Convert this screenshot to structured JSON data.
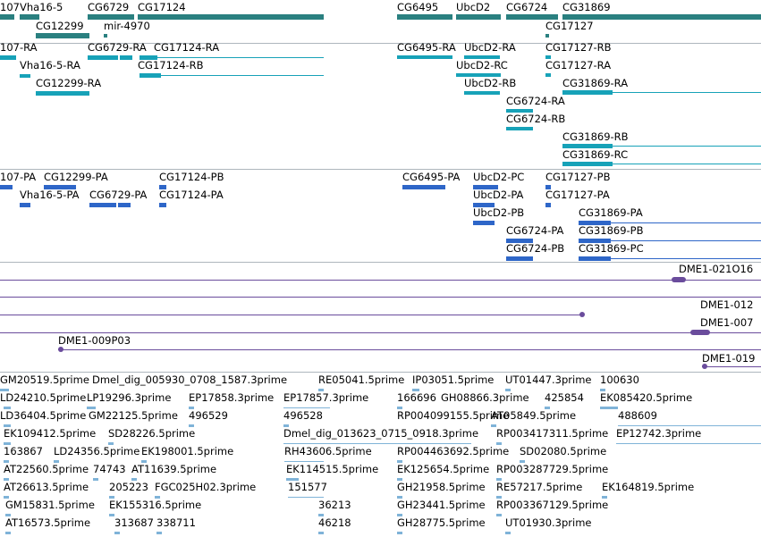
{
  "tracks": {
    "genes": {
      "labels": [
        "107",
        "Vha16-5",
        "CG6729",
        "CG17124",
        "CG12299",
        "mir-4970",
        "CG6495",
        "UbcD2",
        "CG6724",
        "CG31869",
        "CG17127"
      ]
    },
    "transcripts": {
      "labels": [
        "107-RA",
        "Vha16-5-RA",
        "CG12299-RA",
        "CG6729-RA",
        "CG17124-RA",
        "CG17124-RB",
        "CG6495-RA",
        "UbcD2-RA",
        "UbcD2-RC",
        "UbcD2-RB",
        "CG17127-RB",
        "CG17127-RA",
        "CG31869-RA",
        "CG6724-RA",
        "CG6724-RB",
        "CG31869-RB",
        "CG31869-RC"
      ]
    },
    "proteins": {
      "labels": [
        "107-PA",
        "CG12299-PA",
        "CG17124-PB",
        "Vha16-5-PA",
        "CG6729-PA",
        "CG17124-PA",
        "CG6495-PA",
        "UbcD2-PC",
        "UbcD2-PA",
        "UbcD2-PB",
        "CG17127-PB",
        "CG17127-PA",
        "CG6724-PA",
        "CG6724-PB",
        "CG31869-PA",
        "CG31869-PB",
        "CG31869-PC"
      ]
    },
    "probes": {
      "labels": [
        "DME1-021O16",
        "DME1-012",
        "DME1-007",
        "DME1-009P03",
        "DME1-019"
      ]
    },
    "ests": {
      "labels": [
        "GM20519.5prime",
        "Dmel_dig_005930_0708_1587.3prime",
        "RE05041.5prime",
        "IP03051.5prime",
        "UT01447.3prime",
        "100630",
        "LD24210.5prime",
        "LP19296.3prime",
        "EP17858.3prime",
        "EP17857.3prime",
        "166696",
        "GH08866.3prime",
        "425854",
        "EK085420.5prime",
        "LD36404.5prime",
        "GM22125.5prime",
        "496529",
        "496528",
        "RP004099155.5prime",
        "AT05849.5prime",
        "488609",
        "EK109412.5prime",
        "SD28226.5prime",
        "Dmel_dig_013623_0715_0918.3prime",
        "RP003417311.5prime",
        "EP12742.3prime",
        "163867",
        "LD24356.5prime",
        "EK198001.5prime",
        "RH43606.5prime",
        "RP004463692.5prime",
        "SD02080.5prime",
        "AT22560.5prime",
        "74743",
        "AT11639.5prime",
        "EK114515.5prime",
        "EK125654.5prime",
        "RP003287729.5prime",
        "AT26613.5prime",
        "205223",
        "FGC025H02.3prime",
        "151577",
        "GH21958.5prime",
        "RE57217.5prime",
        "EK164819.5prime",
        "GM15831.5prime",
        "EK155316.5prime",
        "36213",
        "GH23441.5prime",
        "RP003367129.5prime",
        "AT16573.5prime",
        "313687",
        "338711",
        "46218",
        "GH28775.5prime",
        "UT01930.3prime"
      ]
    }
  },
  "colors": {
    "gene": "#2a8080",
    "transcript": "#17a2b8",
    "protein": "#2e66c8",
    "probe": "#6a4c9c",
    "est": "#7fb3d8"
  }
}
